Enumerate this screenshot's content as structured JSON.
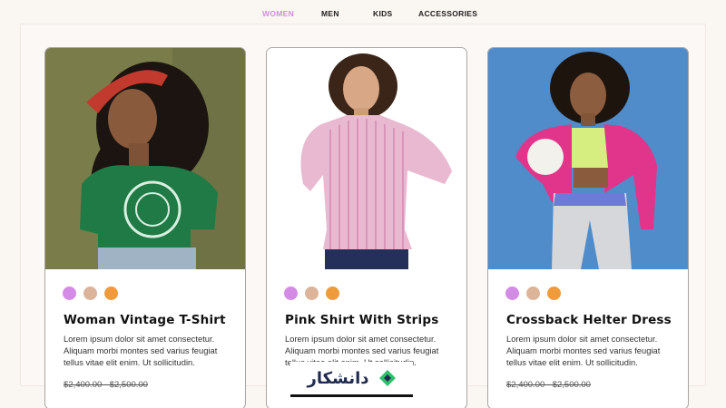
{
  "nav": {
    "items": [
      "WOMEN",
      "MEN",
      "KIDS",
      "ACCESSORIES"
    ],
    "active": "WOMEN"
  },
  "colors": {
    "accent": "#d48be5",
    "swatch_1": "#d48be5",
    "swatch_2": "#dcb49a",
    "swatch_3": "#ef9b3b"
  },
  "products": [
    {
      "title": "Woman Vintage T-Shirt",
      "description": "Lorem ipsum dolor sit amet consectetur. Aliquam morbi montes sed varius feugiat tellus vitae elit enim. Ut sollicitudin.",
      "price": "$2,400.00 - $2,500.00"
    },
    {
      "title": "Pink Shirt With Strips",
      "description": "Lorem ipsum dolor sit amet consectetur. Aliquam morbi montes sed varius feugiat tellus vitae elit enim. Ut sollicitudin."
    },
    {
      "title": "Crossback Helter Dress",
      "description": "Lorem ipsum dolor sit amet consectetur. Aliquam morbi montes sed varius feugiat tellus vitae elit enim. Ut sollicitudin.",
      "price": "$2,400.00 - $2,500.00"
    }
  ],
  "watermark": {
    "text": "دانشکار"
  }
}
